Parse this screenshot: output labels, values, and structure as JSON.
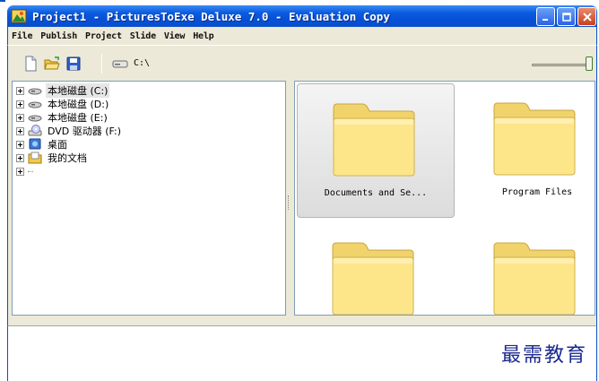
{
  "window": {
    "title": "Project1 - PicturesToExe Deluxe 7.0 - Evaluation Copy",
    "controls": [
      "minimize-icon",
      "maximize-icon",
      "close-icon"
    ]
  },
  "menu": {
    "items": [
      "File",
      "Publish",
      "Project",
      "Slide",
      "View",
      "Help"
    ]
  },
  "toolbar": {
    "icons": [
      "new-file-icon",
      "open-folder-icon",
      "save-icon",
      "drive-icon"
    ],
    "current_path": "C:\\",
    "zoom_slider_fraction": 1.0
  },
  "tree": {
    "items": [
      {
        "label": "本地磁盘 (C:)",
        "icon": "hard-drive-icon",
        "selected": true
      },
      {
        "label": "本地磁盘 (D:)",
        "icon": "hard-drive-icon"
      },
      {
        "label": "本地磁盘 (E:)",
        "icon": "hard-drive-icon"
      },
      {
        "label": "DVD 驱动器 (F:)",
        "icon": "dvd-drive-icon"
      },
      {
        "label": "桌面",
        "icon": "desktop-icon"
      },
      {
        "label": "我的文档",
        "icon": "my-documents-icon"
      }
    ]
  },
  "files": {
    "items": [
      {
        "label": "Documents and Se...",
        "icon": "folder-icon",
        "selected": true
      },
      {
        "label": "Program Files",
        "icon": "folder-icon"
      },
      {
        "label": "",
        "icon": "folder-icon"
      },
      {
        "label": "",
        "icon": "folder-icon"
      }
    ]
  },
  "preview": {
    "watermark": "最需教育"
  },
  "colors": {
    "titlebar": "#0a5be0",
    "chrome": "#ece9d8",
    "panel_border": "#7f9db9",
    "folder_fill": "#fde58a",
    "watermark": "#1b2a8f"
  }
}
